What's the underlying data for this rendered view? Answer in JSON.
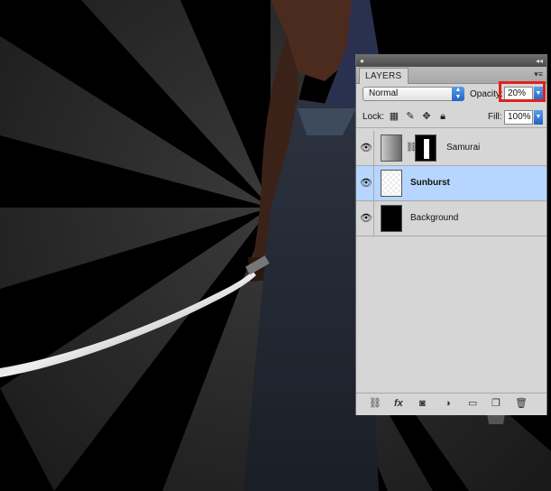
{
  "panel": {
    "tab_label": "LAYERS",
    "blend_mode": "Normal",
    "opacity_label": "Opacity:",
    "opacity_value": "20%",
    "lock_label": "Lock:",
    "fill_label": "Fill:",
    "fill_value": "100%"
  },
  "layers": [
    {
      "name": "Samurai",
      "visible": true,
      "selected": false,
      "has_mask": true
    },
    {
      "name": "Sunburst",
      "visible": true,
      "selected": true,
      "has_mask": false
    },
    {
      "name": "Background",
      "visible": true,
      "selected": false,
      "has_mask": false
    }
  ],
  "bottom_icons": [
    "link-icon",
    "fx-icon",
    "mask-icon",
    "adjustment-icon",
    "folder-icon",
    "new-layer-icon",
    "trash-icon"
  ],
  "colors": {
    "selection": "#b7d6ff",
    "highlight_box": "#e0221c"
  }
}
